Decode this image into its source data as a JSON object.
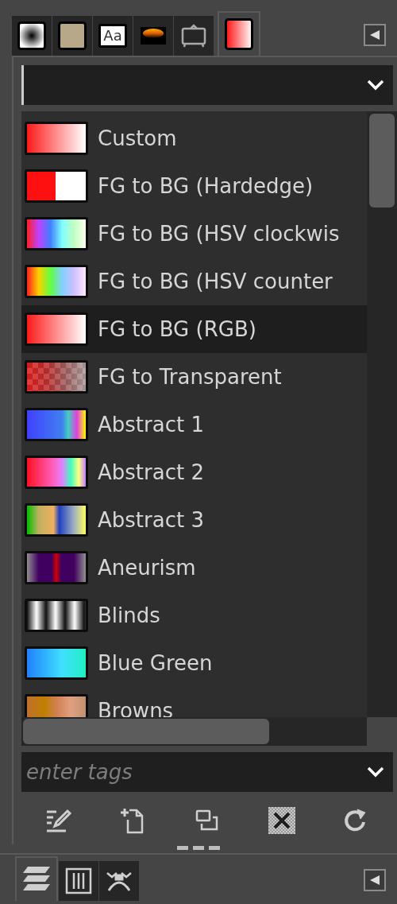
{
  "top_tabs": [
    {
      "kind": "brush",
      "selected": false
    },
    {
      "kind": "pattern",
      "selected": false
    },
    {
      "kind": "font",
      "label": "Aa",
      "selected": false
    },
    {
      "kind": "palette",
      "selected": false
    },
    {
      "kind": "device",
      "selected": false
    },
    {
      "kind": "gradient",
      "selected": true
    }
  ],
  "gradients": [
    {
      "name": "Custom",
      "kind": "fade",
      "selected": false
    },
    {
      "name": "FG to BG (Hardedge)",
      "kind": "hardedge",
      "selected": false
    },
    {
      "name": "FG to BG (HSV clockwis",
      "kind": "hsvcw",
      "selected": false
    },
    {
      "name": "FG to BG (HSV counter",
      "kind": "hsvccw",
      "selected": false
    },
    {
      "name": "FG to BG (RGB)",
      "kind": "fade",
      "selected": true
    },
    {
      "name": "FG to Transparent",
      "kind": "transparent",
      "selected": false
    },
    {
      "name": "Abstract 1",
      "kind": "abstract1",
      "selected": false
    },
    {
      "name": "Abstract 2",
      "kind": "abstract2",
      "selected": false
    },
    {
      "name": "Abstract 3",
      "kind": "abstract3",
      "selected": false
    },
    {
      "name": "Aneurism",
      "kind": "aneurism",
      "selected": false
    },
    {
      "name": "Blinds",
      "kind": "blinds",
      "selected": false
    },
    {
      "name": "Blue Green",
      "kind": "bluegreen",
      "selected": false
    },
    {
      "name": "Browns",
      "kind": "browns",
      "selected": false
    }
  ],
  "tags_field": {
    "placeholder": "enter tags"
  },
  "actions": [
    {
      "kind": "edit"
    },
    {
      "kind": "new"
    },
    {
      "kind": "duplicate"
    },
    {
      "kind": "delete"
    },
    {
      "kind": "refresh"
    }
  ],
  "bottom_tabs": [
    {
      "kind": "layers",
      "selected": true
    },
    {
      "kind": "channels",
      "selected": false
    },
    {
      "kind": "paths",
      "selected": false
    }
  ]
}
